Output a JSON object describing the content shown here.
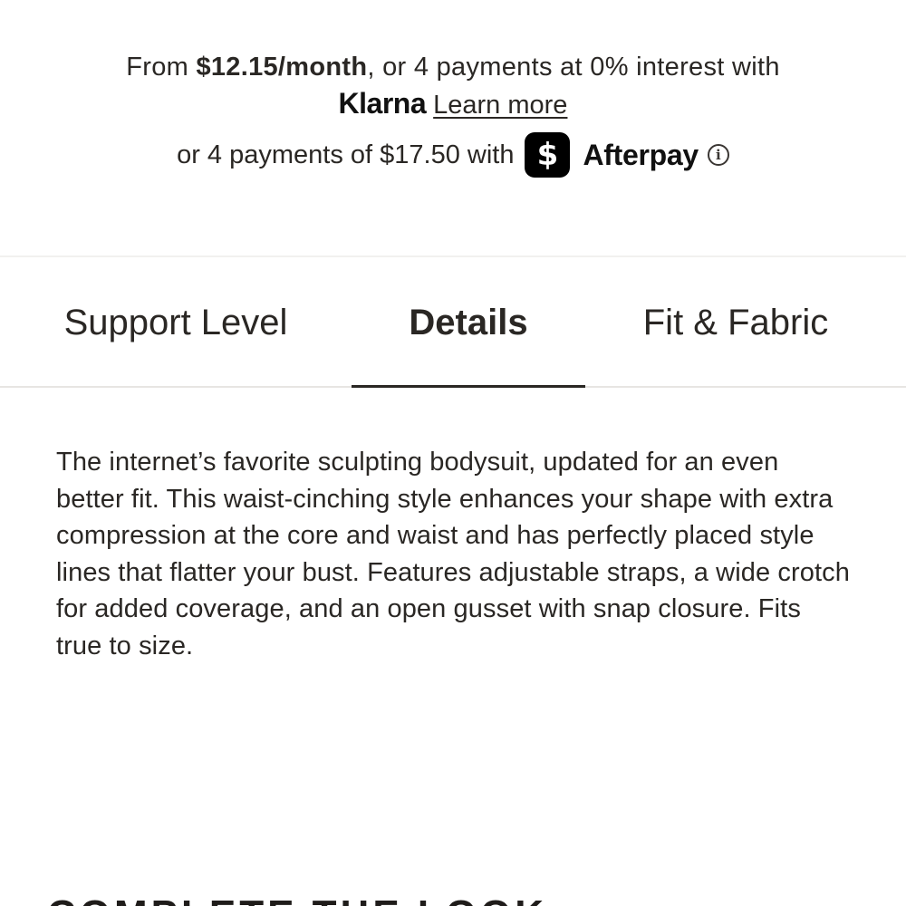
{
  "financing": {
    "klarna_prefix": "From ",
    "klarna_amount": "$12.15/month",
    "klarna_suffix": ", or 4 payments at 0% interest with",
    "klarna_logo": "Klarna",
    "klarna_link": "Learn more",
    "afterpay_text": "or 4 payments of $17.50 with",
    "cashapp_icon_glyph": "$",
    "cashapp_icon": "cash-app-icon",
    "afterpay_logo": "Afterpay",
    "info_icon_glyph": "i",
    "info_icon": "info-icon"
  },
  "tabs": [
    {
      "label": "Support Level",
      "active": false
    },
    {
      "label": "Details",
      "active": true
    },
    {
      "label": "Fit & Fabric",
      "active": false
    }
  ],
  "details": {
    "description": "The internet’s favorite sculpting bodysuit, updated for an even better fit. This waist-cinching style enhances your shape with extra compression at the core and waist and has perfectly placed style lines that flatter your bust. Features adjustable straps, a wide crotch for added coverage, and an open gusset with snap closure. Fits true to size."
  },
  "section": {
    "complete_the_look": "COMPLETE THE LOOK"
  },
  "colors": {
    "text": "#2a2724",
    "background": "#ffffff",
    "cashapp_bg": "#000000"
  }
}
